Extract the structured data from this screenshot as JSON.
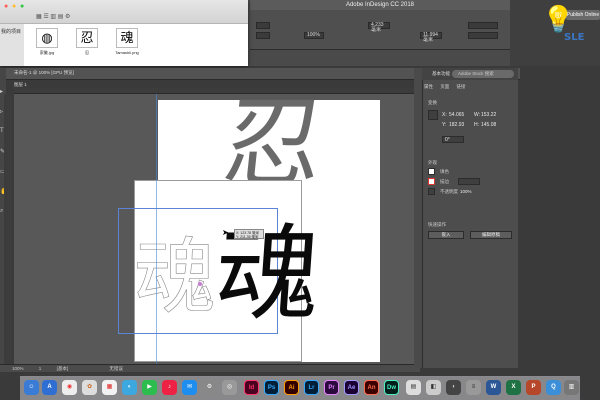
{
  "indesign": {
    "window_title": "Adobe InDesign CC 2018",
    "publish_button": "Publish Online",
    "workspace": "基本功能",
    "search_placeholder": "Adobe Stock 搜索",
    "document_tab": "未命名-1 @ 100% [GPU 预览]",
    "breadcrumb": "图层 1",
    "control_bar": {
      "x_value": "4.233 毫米",
      "zoom": "100%",
      "y_value": "11.994 毫米"
    },
    "status": {
      "zoom": "100%",
      "page": "1",
      "mode": "[基本]",
      "errors": "无错误"
    }
  },
  "finder": {
    "sidebar_items": [
      "我的项目"
    ],
    "files": [
      {
        "name": "家徽.jpg",
        "glyph": "◍"
      },
      {
        "name": "忍",
        "glyph": "忍"
      },
      {
        "name": "Tamashii.png",
        "glyph": "魂"
      }
    ]
  },
  "canvas": {
    "glyph_top": "忍",
    "glyph_main": "魂",
    "tooltip_line1": "X: 123.78 毫米",
    "tooltip_line2": "Y: 211.35 毫米"
  },
  "properties_panel": {
    "tabs": [
      "属性",
      "页面",
      "链接"
    ],
    "section_transform": "变换",
    "x_label": "X:",
    "x_value": "54.065",
    "y_label": "Y:",
    "y_value": "182.93",
    "w_label": "W:",
    "w_value": "153.22",
    "h_label": "H:",
    "h_value": "145.08",
    "angle_value": "0°",
    "section_appearance": "外观",
    "fill_label": "填色",
    "stroke_label": "描边",
    "opacity_label": "不透明度",
    "opacity_value": "100%",
    "section_quick_actions": "快速操作",
    "btn_embed": "嵌入",
    "btn_edit_original": "编辑原稿"
  },
  "dock_apps": [
    {
      "label": "Id",
      "color": "#49021f",
      "fg": "#ff3366"
    },
    {
      "label": "Ps",
      "color": "#001e36",
      "fg": "#31a8ff"
    },
    {
      "label": "Ai",
      "color": "#330000",
      "fg": "#ff9a00"
    },
    {
      "label": "Lr",
      "color": "#001e36",
      "fg": "#31a8ff"
    },
    {
      "label": "Pr",
      "color": "#2a0a3c",
      "fg": "#e77cff"
    },
    {
      "label": "Ae",
      "color": "#1a0033",
      "fg": "#9999ff"
    },
    {
      "label": "An",
      "color": "#3b0000",
      "fg": "#ff6b4a"
    },
    {
      "label": "Dw",
      "color": "#001e1a",
      "fg": "#4af0c3"
    }
  ],
  "watermark_text": "SLE"
}
